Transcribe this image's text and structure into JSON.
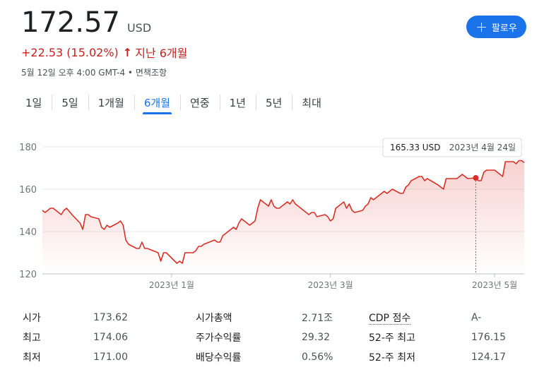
{
  "quote": {
    "price": "172.57",
    "currency": "USD",
    "change": "+22.53 (15.02%)",
    "change_arrow": "↑",
    "period": "지난 6개월",
    "meta": "5월 12일 오후 4:00 GMT-4 • 면책조항"
  },
  "follow_button": {
    "label": "팔로우",
    "icon": "plus-icon"
  },
  "tabs": [
    {
      "label": "1일"
    },
    {
      "label": "5일"
    },
    {
      "label": "1개월"
    },
    {
      "label": "6개월",
      "active": true
    },
    {
      "label": "연중"
    },
    {
      "label": "1년"
    },
    {
      "label": "5년"
    },
    {
      "label": "최대"
    }
  ],
  "tooltip": {
    "value": "165.33 USD",
    "date": "2023년 4월 24일"
  },
  "colors": {
    "line": "#d93025",
    "accent": "#1a73e8",
    "grid": "#e8eaed",
    "text": "#70757a"
  },
  "chart_data": {
    "type": "area",
    "ylim": [
      120,
      180
    ],
    "yticks": [
      120,
      140,
      160,
      180
    ],
    "xlim": [
      "2022-11-14",
      "2023-05-12"
    ],
    "xticks": [
      {
        "date": "2023-01-01",
        "label": "2023년 1월"
      },
      {
        "date": "2023-03-01",
        "label": "2023년 3월"
      },
      {
        "date": "2023-05-01",
        "label": "2023년 5월"
      }
    ],
    "highlight": {
      "date": "2023-04-24",
      "value": 165.33
    },
    "points": [
      [
        "2022-11-14",
        150
      ],
      [
        "2022-11-15",
        149
      ],
      [
        "2022-11-16",
        150
      ],
      [
        "2022-11-17",
        151
      ],
      [
        "2022-11-18",
        151
      ],
      [
        "2022-11-21",
        148
      ],
      [
        "2022-11-22",
        150
      ],
      [
        "2022-11-23",
        151
      ],
      [
        "2022-11-25",
        148
      ],
      [
        "2022-11-28",
        144
      ],
      [
        "2022-11-29",
        141
      ],
      [
        "2022-11-30",
        148
      ],
      [
        "2022-12-01",
        148
      ],
      [
        "2022-12-02",
        147
      ],
      [
        "2022-12-05",
        146
      ],
      [
        "2022-12-06",
        142
      ],
      [
        "2022-12-07",
        141
      ],
      [
        "2022-12-08",
        143
      ],
      [
        "2022-12-09",
        142
      ],
      [
        "2022-12-12",
        144
      ],
      [
        "2022-12-13",
        145
      ],
      [
        "2022-12-14",
        143
      ],
      [
        "2022-12-15",
        136
      ],
      [
        "2022-12-16",
        134
      ],
      [
        "2022-12-19",
        132
      ],
      [
        "2022-12-20",
        132
      ],
      [
        "2022-12-21",
        135
      ],
      [
        "2022-12-22",
        132
      ],
      [
        "2022-12-23",
        132
      ],
      [
        "2022-12-27",
        130
      ],
      [
        "2022-12-28",
        126
      ],
      [
        "2022-12-29",
        130
      ],
      [
        "2022-12-30",
        130
      ],
      [
        "2023-01-03",
        125
      ],
      [
        "2023-01-04",
        126
      ],
      [
        "2023-01-05",
        125
      ],
      [
        "2023-01-06",
        130
      ],
      [
        "2023-01-09",
        130
      ],
      [
        "2023-01-10",
        131
      ],
      [
        "2023-01-11",
        133
      ],
      [
        "2023-01-12",
        133
      ],
      [
        "2023-01-13",
        134
      ],
      [
        "2023-01-17",
        136
      ],
      [
        "2023-01-18",
        135
      ],
      [
        "2023-01-19",
        135
      ],
      [
        "2023-01-20",
        138
      ],
      [
        "2023-01-23",
        141
      ],
      [
        "2023-01-24",
        142
      ],
      [
        "2023-01-25",
        141
      ],
      [
        "2023-01-26",
        144
      ],
      [
        "2023-01-27",
        146
      ],
      [
        "2023-01-30",
        143
      ],
      [
        "2023-01-31",
        144
      ],
      [
        "2023-02-01",
        145
      ],
      [
        "2023-02-02",
        151
      ],
      [
        "2023-02-03",
        155
      ],
      [
        "2023-02-06",
        152
      ],
      [
        "2023-02-07",
        155
      ],
      [
        "2023-02-08",
        152
      ],
      [
        "2023-02-09",
        151
      ],
      [
        "2023-02-10",
        151
      ],
      [
        "2023-02-13",
        154
      ],
      [
        "2023-02-14",
        153
      ],
      [
        "2023-02-15",
        155
      ],
      [
        "2023-02-16",
        153
      ],
      [
        "2023-02-17",
        152
      ],
      [
        "2023-02-21",
        148
      ],
      [
        "2023-02-22",
        149
      ],
      [
        "2023-02-23",
        149
      ],
      [
        "2023-02-24",
        147
      ],
      [
        "2023-02-27",
        148
      ],
      [
        "2023-02-28",
        147
      ],
      [
        "2023-03-01",
        145
      ],
      [
        "2023-03-02",
        146
      ],
      [
        "2023-03-03",
        151
      ],
      [
        "2023-03-06",
        154
      ],
      [
        "2023-03-07",
        151
      ],
      [
        "2023-03-08",
        153
      ],
      [
        "2023-03-09",
        150
      ],
      [
        "2023-03-10",
        149
      ],
      [
        "2023-03-13",
        150
      ],
      [
        "2023-03-14",
        152
      ],
      [
        "2023-03-15",
        153
      ],
      [
        "2023-03-16",
        156
      ],
      [
        "2023-03-17",
        155
      ],
      [
        "2023-03-20",
        158
      ],
      [
        "2023-03-21",
        159
      ],
      [
        "2023-03-22",
        158
      ],
      [
        "2023-03-23",
        159
      ],
      [
        "2023-03-24",
        160
      ],
      [
        "2023-03-27",
        158
      ],
      [
        "2023-03-28",
        158
      ],
      [
        "2023-03-29",
        161
      ],
      [
        "2023-03-30",
        162
      ],
      [
        "2023-03-31",
        164
      ],
      [
        "2023-04-03",
        166
      ],
      [
        "2023-04-04",
        166
      ],
      [
        "2023-04-05",
        164
      ],
      [
        "2023-04-06",
        165
      ],
      [
        "2023-04-10",
        162
      ],
      [
        "2023-04-11",
        161
      ],
      [
        "2023-04-12",
        160
      ],
      [
        "2023-04-13",
        165
      ],
      [
        "2023-04-14",
        165
      ],
      [
        "2023-04-17",
        165
      ],
      [
        "2023-04-18",
        166
      ],
      [
        "2023-04-19",
        167
      ],
      [
        "2023-04-20",
        166
      ],
      [
        "2023-04-21",
        165
      ],
      [
        "2023-04-24",
        165.33
      ],
      [
        "2023-04-25",
        164
      ],
      [
        "2023-04-26",
        164
      ],
      [
        "2023-04-27",
        168
      ],
      [
        "2023-04-28",
        169
      ],
      [
        "2023-05-01",
        169
      ],
      [
        "2023-05-02",
        168
      ],
      [
        "2023-05-03",
        167
      ],
      [
        "2023-05-04",
        166
      ],
      [
        "2023-05-05",
        173
      ],
      [
        "2023-05-08",
        173
      ],
      [
        "2023-05-09",
        172
      ],
      [
        "2023-05-10",
        173.5
      ],
      [
        "2023-05-11",
        173.5
      ],
      [
        "2023-05-12",
        172.57
      ]
    ]
  },
  "stats": [
    {
      "l1": "시가",
      "v1": "173.62",
      "l2": "시가총액",
      "v2": "2.71조",
      "l3": "CDP 점수",
      "v3": "A-"
    },
    {
      "l1": "최고",
      "v1": "174.06",
      "l2": "주가수익률",
      "v2": "29.32",
      "l3": "52-주 최고",
      "v3": "176.15"
    },
    {
      "l1": "최저",
      "v1": "171.00",
      "l2": "배당수익률",
      "v2": "0.56%",
      "l3": "52-주 최저",
      "v3": "124.17"
    }
  ]
}
